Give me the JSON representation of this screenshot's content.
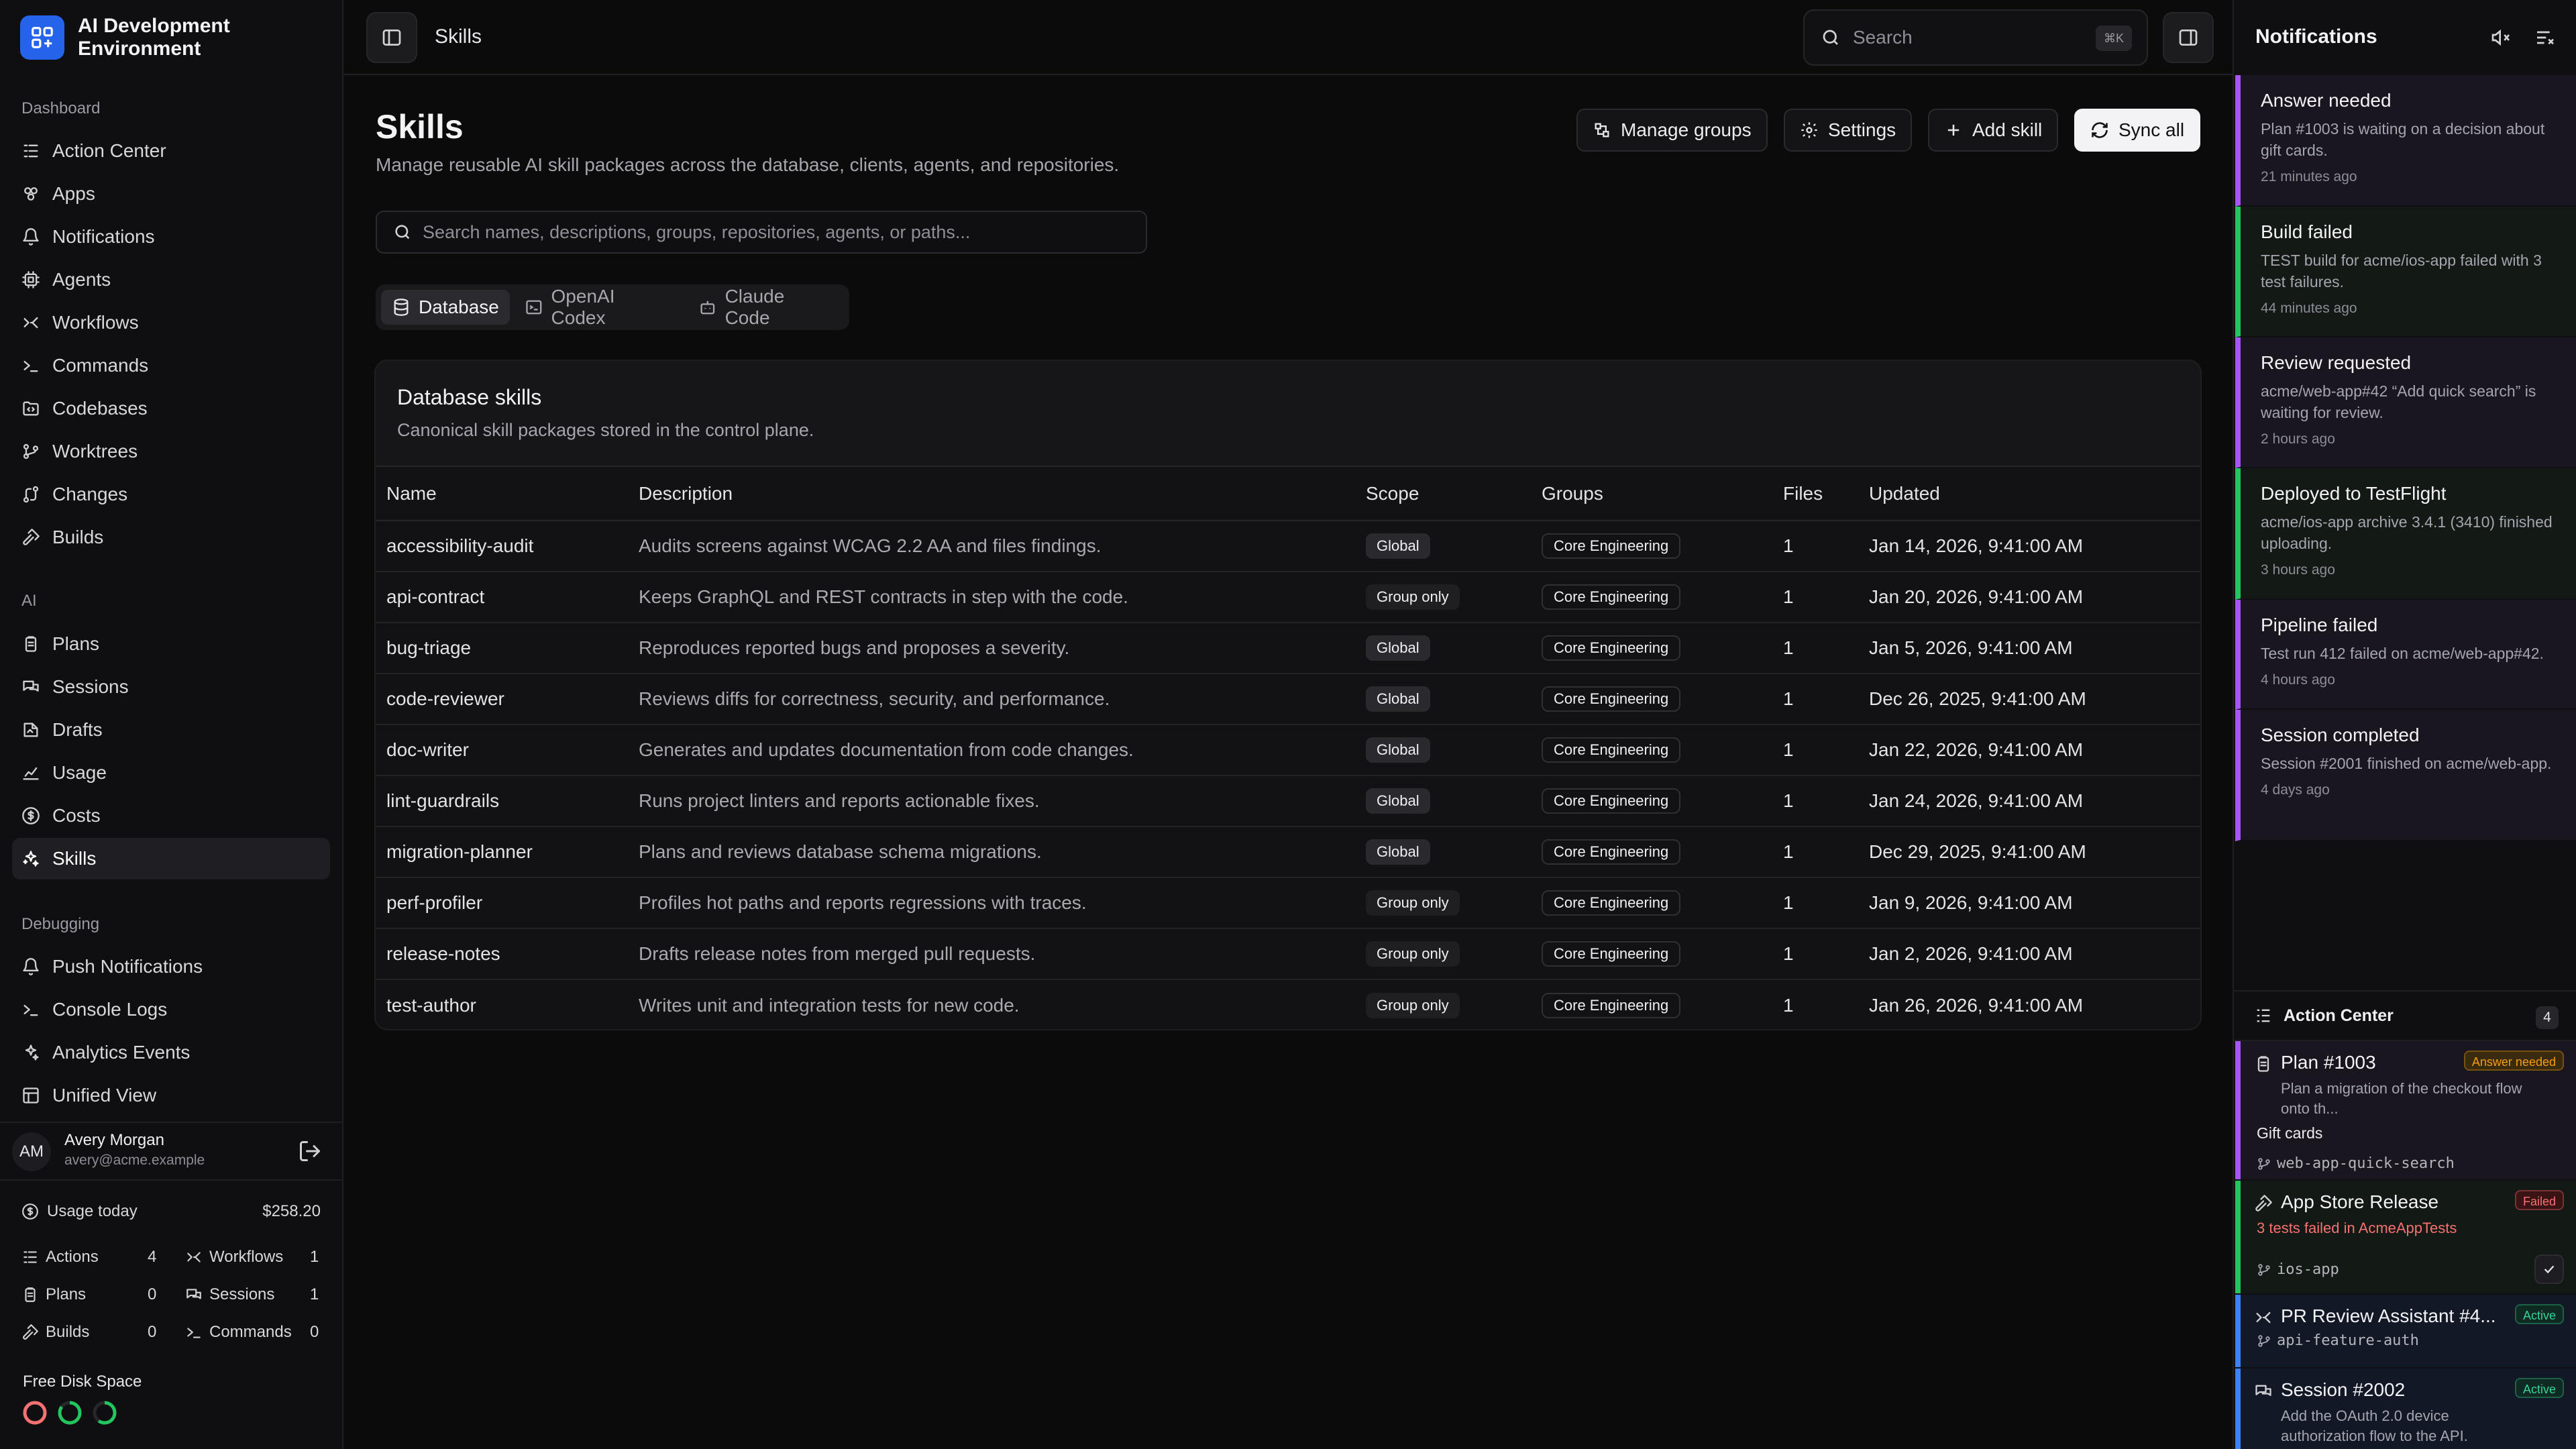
{
  "app": {
    "title": "AI Development Environment"
  },
  "sidebar": {
    "sections": [
      {
        "label": "Dashboard",
        "items": [
          {
            "label": "Action Center",
            "icon": "action-center-icon"
          },
          {
            "label": "Apps",
            "icon": "apps-icon"
          },
          {
            "label": "Notifications",
            "icon": "bell-icon"
          },
          {
            "label": "Agents",
            "icon": "agent-icon"
          },
          {
            "label": "Workflows",
            "icon": "workflow-icon"
          },
          {
            "label": "Commands",
            "icon": "terminal-icon"
          },
          {
            "label": "Codebases",
            "icon": "folder-code-icon"
          },
          {
            "label": "Worktrees",
            "icon": "branch-icon"
          },
          {
            "label": "Changes",
            "icon": "diff-icon"
          },
          {
            "label": "Builds",
            "icon": "hammer-icon"
          }
        ]
      },
      {
        "label": "AI",
        "items": [
          {
            "label": "Plans",
            "icon": "clipboard-icon"
          },
          {
            "label": "Sessions",
            "icon": "chat-icon"
          },
          {
            "label": "Drafts",
            "icon": "draft-icon"
          },
          {
            "label": "Usage",
            "icon": "chart-icon"
          },
          {
            "label": "Costs",
            "icon": "dollar-icon"
          },
          {
            "label": "Skills",
            "icon": "skills-icon"
          }
        ]
      },
      {
        "label": "Debugging",
        "items": [
          {
            "label": "Push Notifications",
            "icon": "bell-icon"
          },
          {
            "label": "Console Logs",
            "icon": "terminal-icon"
          },
          {
            "label": "Analytics Events",
            "icon": "sparkle-icon"
          },
          {
            "label": "Unified View",
            "icon": "layout-icon"
          }
        ]
      }
    ],
    "active": "Skills",
    "user": {
      "initials": "AM",
      "name": "Avery Morgan",
      "email": "avery@acme.example"
    },
    "usage": {
      "label": "Usage today",
      "amount": "$258.20",
      "stats": [
        {
          "label": "Actions",
          "value": "4",
          "icon": "action-center-icon"
        },
        {
          "label": "Workflows",
          "value": "1",
          "icon": "workflow-icon"
        },
        {
          "label": "Plans",
          "value": "0",
          "icon": "clipboard-icon"
        },
        {
          "label": "Sessions",
          "value": "1",
          "icon": "chat-icon"
        },
        {
          "label": "Builds",
          "value": "0",
          "icon": "hammer-icon"
        },
        {
          "label": "Commands",
          "value": "0",
          "icon": "terminal-icon"
        }
      ]
    },
    "disk": {
      "label": "Free Disk Space",
      "rings": [
        {
          "color": "#f87171",
          "fraction": 1.0
        },
        {
          "color": "#22c55e",
          "fraction": 0.85
        },
        {
          "color": "#22c55e",
          "fraction": 0.6
        }
      ]
    }
  },
  "topbar": {
    "breadcrumb": "Skills",
    "search_placeholder": "Search",
    "shortcut": "⌘K"
  },
  "main": {
    "title": "Skills",
    "subtitle": "Manage reusable AI skill packages across the database, clients, agents, and repositories.",
    "actions": [
      {
        "label": "Manage groups",
        "icon": "groups-icon"
      },
      {
        "label": "Settings",
        "icon": "gear-icon"
      },
      {
        "label": "Add skill",
        "icon": "plus-icon"
      },
      {
        "label": "Sync all",
        "icon": "sync-icon"
      }
    ],
    "search_placeholder": "Search names, descriptions, groups, repositories, agents, or paths...",
    "tabs": [
      {
        "label": "Database",
        "icon": "database-icon"
      },
      {
        "label": "OpenAI Codex",
        "icon": "terminal-window-icon"
      },
      {
        "label": "Claude Code",
        "icon": "robot-icon"
      }
    ],
    "active_tab": "Database",
    "card": {
      "title": "Database skills",
      "subtitle": "Canonical skill packages stored in the control plane.",
      "columns": [
        "Name",
        "Description",
        "Scope",
        "Groups",
        "Files",
        "Updated"
      ],
      "rows": [
        {
          "name": "accessibility-audit",
          "description": "Audits screens against WCAG 2.2 AA and files findings.",
          "scope": "Global",
          "group": "Core Engineering",
          "files": "1",
          "updated": "Jan 14, 2026, 9:41:00 AM"
        },
        {
          "name": "api-contract",
          "description": "Keeps GraphQL and REST contracts in step with the code.",
          "scope": "Group only",
          "group": "Core Engineering",
          "files": "1",
          "updated": "Jan 20, 2026, 9:41:00 AM"
        },
        {
          "name": "bug-triage",
          "description": "Reproduces reported bugs and proposes a severity.",
          "scope": "Global",
          "group": "Core Engineering",
          "files": "1",
          "updated": "Jan 5, 2026, 9:41:00 AM"
        },
        {
          "name": "code-reviewer",
          "description": "Reviews diffs for correctness, security, and performance.",
          "scope": "Global",
          "group": "Core Engineering",
          "files": "1",
          "updated": "Dec 26, 2025, 9:41:00 AM"
        },
        {
          "name": "doc-writer",
          "description": "Generates and updates documentation from code changes.",
          "scope": "Global",
          "group": "Core Engineering",
          "files": "1",
          "updated": "Jan 22, 2026, 9:41:00 AM"
        },
        {
          "name": "lint-guardrails",
          "description": "Runs project linters and reports actionable fixes.",
          "scope": "Global",
          "group": "Core Engineering",
          "files": "1",
          "updated": "Jan 24, 2026, 9:41:00 AM"
        },
        {
          "name": "migration-planner",
          "description": "Plans and reviews database schema migrations.",
          "scope": "Global",
          "group": "Core Engineering",
          "files": "1",
          "updated": "Dec 29, 2025, 9:41:00 AM"
        },
        {
          "name": "perf-profiler",
          "description": "Profiles hot paths and reports regressions with traces.",
          "scope": "Group only",
          "group": "Core Engineering",
          "files": "1",
          "updated": "Jan 9, 2026, 9:41:00 AM"
        },
        {
          "name": "release-notes",
          "description": "Drafts release notes from merged pull requests.",
          "scope": "Group only",
          "group": "Core Engineering",
          "files": "1",
          "updated": "Jan 2, 2026, 9:41:00 AM"
        },
        {
          "name": "test-author",
          "description": "Writes unit and integration tests for new code.",
          "scope": "Group only",
          "group": "Core Engineering",
          "files": "1",
          "updated": "Jan 26, 2026, 9:41:00 AM"
        }
      ]
    }
  },
  "notifications": {
    "title": "Notifications",
    "items": [
      {
        "title": "Answer needed",
        "body": "Plan #1003 is waiting on a decision about gift cards.",
        "time": "21 minutes ago",
        "color": "#a855f7",
        "bg": "#1a1620"
      },
      {
        "title": "Build failed",
        "body": "TEST build for acme/ios-app failed with 3 test failures.",
        "time": "44 minutes ago",
        "color": "#22c55e",
        "bg": "#131a15"
      },
      {
        "title": "Review requested",
        "body": "acme/web-app#42 “Add quick search” is waiting for review.",
        "time": "2 hours ago",
        "color": "#a855f7",
        "bg": "#1a1620"
      },
      {
        "title": "Deployed to TestFlight",
        "body": "acme/ios-app archive 3.4.1 (3410) finished uploading.",
        "time": "3 hours ago",
        "color": "#22c55e",
        "bg": "#131a15"
      },
      {
        "title": "Pipeline failed",
        "body": "Test run 412 failed on acme/web-app#42.",
        "time": "4 hours ago",
        "color": "#a855f7",
        "bg": "#1a1620"
      },
      {
        "title": "Session completed",
        "body": "Session #2001 finished on acme/web-app.",
        "time": "4 days ago",
        "color": "#a855f7",
        "bg": "#1a1620"
      }
    ]
  },
  "action_center": {
    "title": "Action Center",
    "count": "4",
    "items": [
      {
        "title": "Plan #1003",
        "badge": "Answer needed",
        "body": "Plan a migration of the checkout flow onto th...",
        "extra": "Gift cards",
        "branch": "web-app-quick-search",
        "color": "#a855f7"
      },
      {
        "title": "App Store Release",
        "badge": "Failed",
        "body": "3 tests failed in AcmeAppTests",
        "branch": "ios-app",
        "color": "#22c55e"
      },
      {
        "title": "PR Review Assistant #4...",
        "badge": "Active",
        "branch": "api-feature-auth",
        "color": "#3b82f6"
      },
      {
        "title": "Session #2002",
        "badge": "Active",
        "body": "Add the OAuth 2.0 device authorization flow to the API.",
        "color": "#3b82f6"
      }
    ]
  }
}
